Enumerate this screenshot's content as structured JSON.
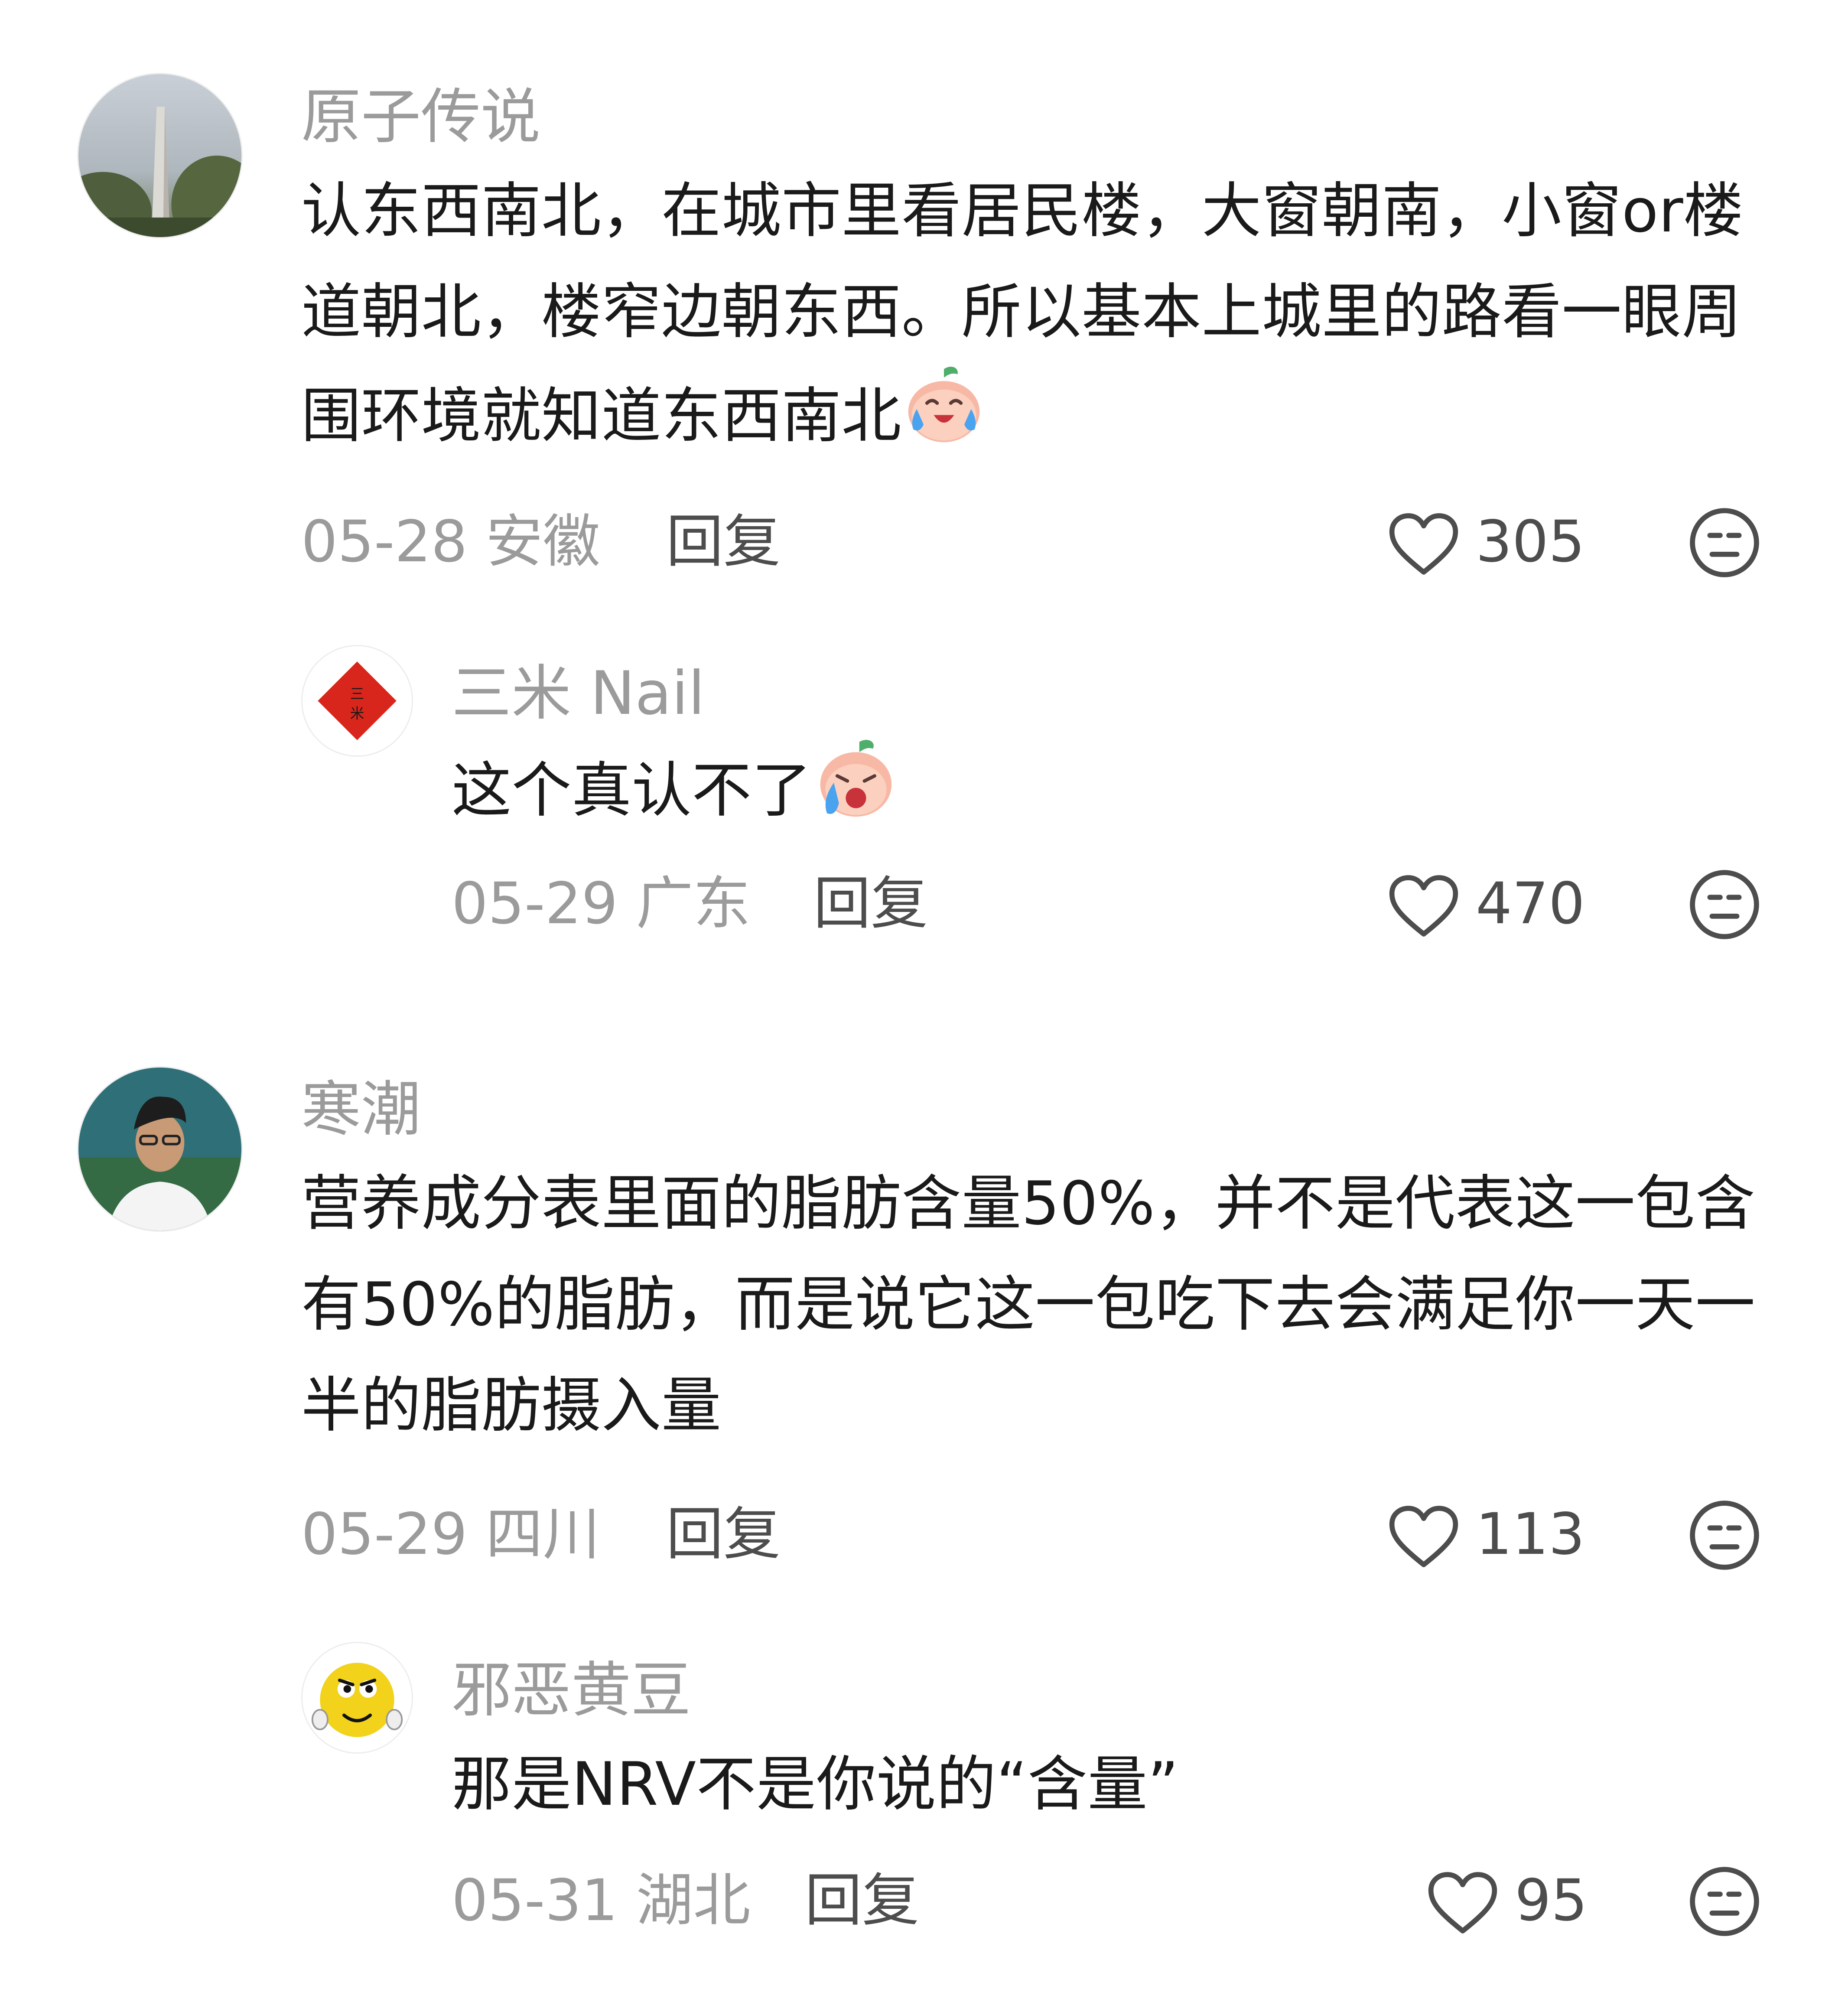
{
  "comments": [
    {
      "username": "原子传说",
      "text": "认东西南北，在城市里看居民楼，大窗朝南，小窗or楼道朝北，楼窄边朝东西。所以基本上城里的路看一眼周围环境就知道东西南北",
      "emoji": "crying-laugh-peach-emoji",
      "date": "05-28",
      "location": "安徽",
      "reply_label": "回复",
      "likes": "305"
    },
    {
      "username": "三米 Nail",
      "text": "这个真认不了",
      "emoji": "crying-peach-emoji",
      "date": "05-29",
      "location": "广东",
      "reply_label": "回复",
      "likes": "470",
      "avatar_text": "三米"
    },
    {
      "username": "寒潮",
      "text": "营养成分表里面的脂肪含量50%，并不是代表这一包含有50%的脂肪，而是说它这一包吃下去会满足你一天一半的脂肪摄入量",
      "date": "05-29",
      "location": "四川",
      "reply_label": "回复",
      "likes": "113"
    },
    {
      "username": "邪恶黄豆",
      "text": "那是NRV不是你说的“含量”",
      "date": "05-31",
      "location": "湖北",
      "reply_label": "回复",
      "likes": "95"
    }
  ],
  "icons": {
    "like": "heart-outline-icon",
    "dislike": "meh-face-icon"
  },
  "colors": {
    "username": "#9b9b9b",
    "text": "#1a1a1a",
    "meta": "#9b9b9b",
    "action": "#4d4d4d",
    "seal_red": "#d9261c"
  }
}
